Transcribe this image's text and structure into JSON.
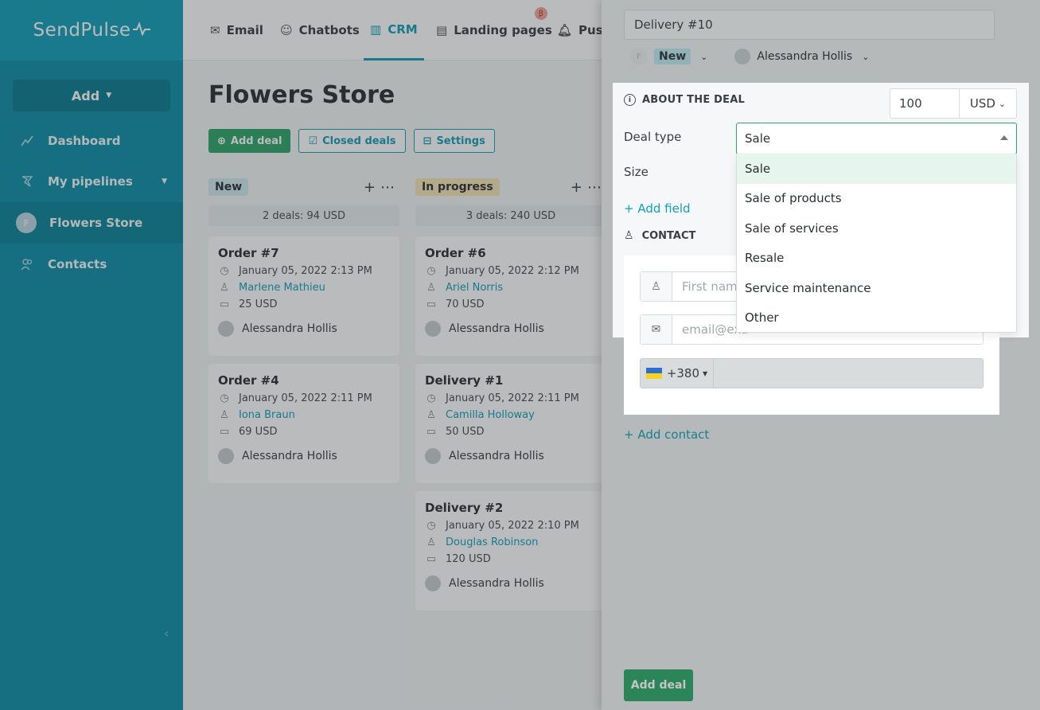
{
  "brand": {
    "logo": "SendPulse"
  },
  "sidebar": {
    "add_label": "Add",
    "items": [
      {
        "label": "Dashboard",
        "icon": "chart-line-icon"
      },
      {
        "label": "My pipelines",
        "icon": "funnel-icon"
      },
      {
        "label": "Flowers Store",
        "avatar": "F"
      },
      {
        "label": "Contacts",
        "icon": "contacts-icon"
      }
    ]
  },
  "topnav": {
    "tabs": [
      {
        "label": "Email"
      },
      {
        "label": "Chatbots"
      },
      {
        "label": "CRM"
      },
      {
        "label": "Landing pages"
      },
      {
        "label": "Push"
      }
    ],
    "beta": "β"
  },
  "board": {
    "title": "Flowers Store",
    "add_deal": "Add deal",
    "closed_deals": "Closed deals",
    "settings": "Settings",
    "columns": [
      {
        "name": "New",
        "summary": "2 deals: 94 USD",
        "cards": [
          {
            "title": "Order #7",
            "date": "January 05, 2022 2:13 PM",
            "contact": "Marlene Mathieu",
            "amount": "25 USD",
            "owner": "Alessandra Hollis"
          },
          {
            "title": "Order #4",
            "date": "January 05, 2022 2:11 PM",
            "contact": "Iona Braun",
            "amount": "69 USD",
            "owner": "Alessandra Hollis"
          }
        ]
      },
      {
        "name": "In progress",
        "summary": "3 deals: 240 USD",
        "cards": [
          {
            "title": "Order #6",
            "date": "January 05, 2022 2:12 PM",
            "contact": "Ariel Norris",
            "amount": "70 USD",
            "owner": "Alessandra Hollis"
          },
          {
            "title": "Delivery #1",
            "date": "January 05, 2022 2:11 PM",
            "contact": "Camilla Holloway",
            "amount": "50 USD",
            "owner": "Alessandra Hollis"
          },
          {
            "title": "Delivery #2",
            "date": "January 05, 2022 2:10 PM",
            "contact": "Douglas Robinson",
            "amount": "120 USD",
            "owner": "Alessandra Hollis"
          }
        ]
      }
    ]
  },
  "panel": {
    "deal_name": "Delivery #10",
    "status": "New",
    "status_avatar": "F",
    "owner": "Alessandra Hollis",
    "about_heading": "ABOUT THE DEAL",
    "amount": "100",
    "currency": "USD",
    "deal_type_label": "Deal type",
    "deal_type_value": "Sale",
    "size_label": "Size",
    "deal_type_options": [
      "Sale",
      "Sale of products",
      "Sale of services",
      "Resale",
      "Service maintenance",
      "Other"
    ],
    "add_field": "+ Add field",
    "contact_heading": "CONTACT",
    "first_name_placeholder": "First name",
    "email_placeholder": "email@exa",
    "phone_code": "+380",
    "add_contact": "+ Add contact",
    "submit": "Add deal"
  }
}
